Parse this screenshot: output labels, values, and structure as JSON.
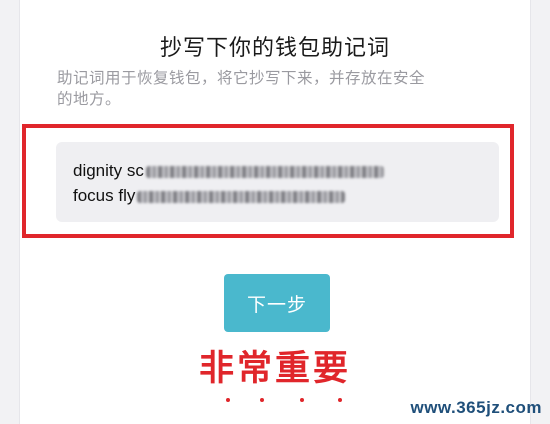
{
  "header": {
    "title": "抄写下你的钱包助记词"
  },
  "instructions": {
    "line1": "助记词用于恢复钱包，将它抄写下来，并存放在安全",
    "line2": "的地方。"
  },
  "mnemonic": {
    "line1_visible": "dignity sc",
    "line2_visible": "focus fly"
  },
  "actions": {
    "next_label": "下一步"
  },
  "annotation": {
    "text": "非常重要",
    "color": "#e0262b"
  },
  "watermark": {
    "text": "www.365jz.com"
  },
  "colors": {
    "button": "#4ab8cd",
    "accent_red": "#e0262b"
  }
}
